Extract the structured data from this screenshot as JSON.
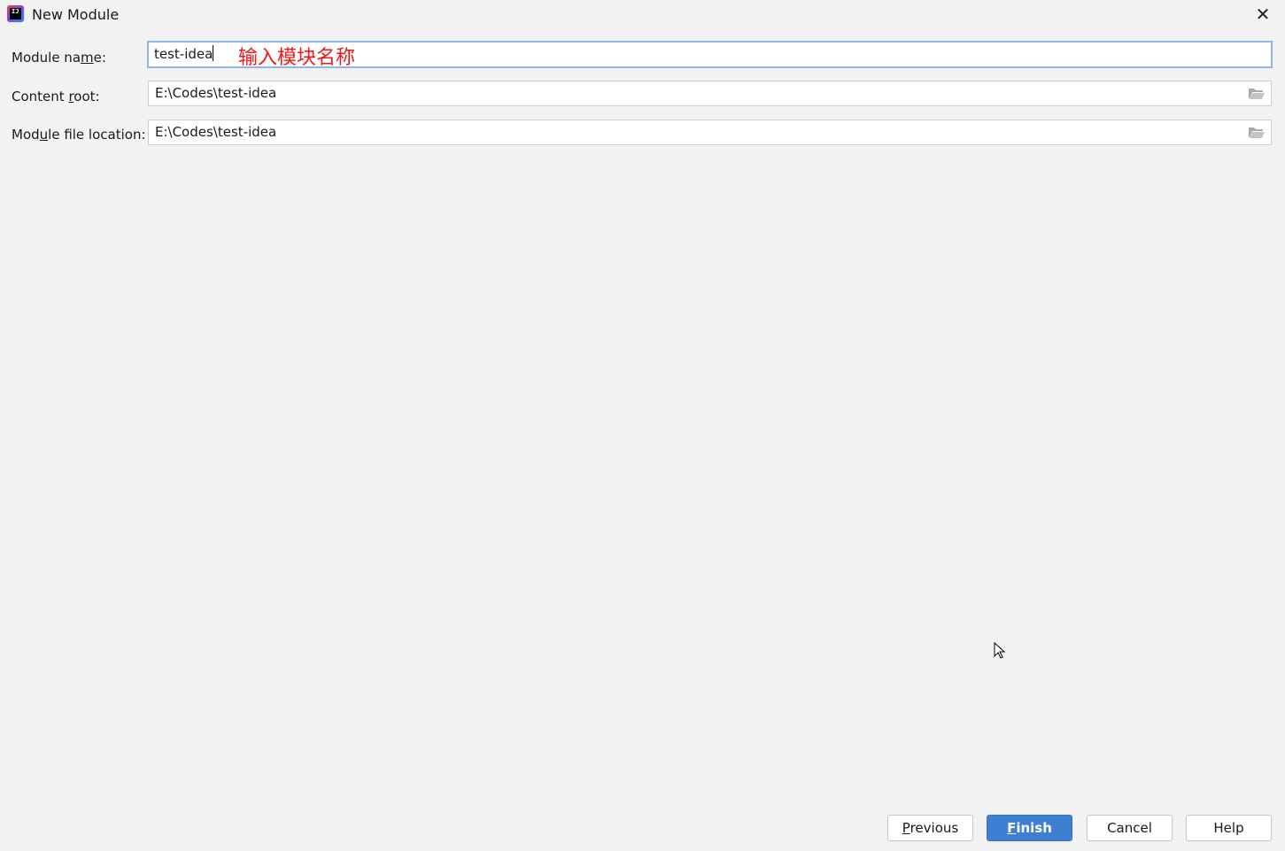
{
  "window": {
    "title": "New Module",
    "app_icon": "intellij-idea-icon",
    "close_icon": "close-icon"
  },
  "form": {
    "module_name": {
      "label_pre": "Module na",
      "label_mnemonic": "m",
      "label_post": "e:",
      "value": "test-idea",
      "annotation": "输入模块名称"
    },
    "content_root": {
      "label_pre": "Content ",
      "label_mnemonic": "r",
      "label_post": "oot:",
      "value": "E:\\Codes\\test-idea",
      "icon": "folder-icon"
    },
    "module_file_location": {
      "label_pre": "Mod",
      "label_mnemonic": "u",
      "label_post": "le file location:",
      "value": "E:\\Codes\\test-idea",
      "icon": "folder-icon"
    }
  },
  "buttons": {
    "previous": {
      "mnemonic": "P",
      "rest": "revious"
    },
    "finish": {
      "mnemonic": "F",
      "rest": "inish"
    },
    "cancel": "Cancel",
    "help": "Help"
  },
  "colors": {
    "primary_button": "#3e7fd1",
    "annotation": "#f01818",
    "focus_border": "#8fb4e6"
  }
}
